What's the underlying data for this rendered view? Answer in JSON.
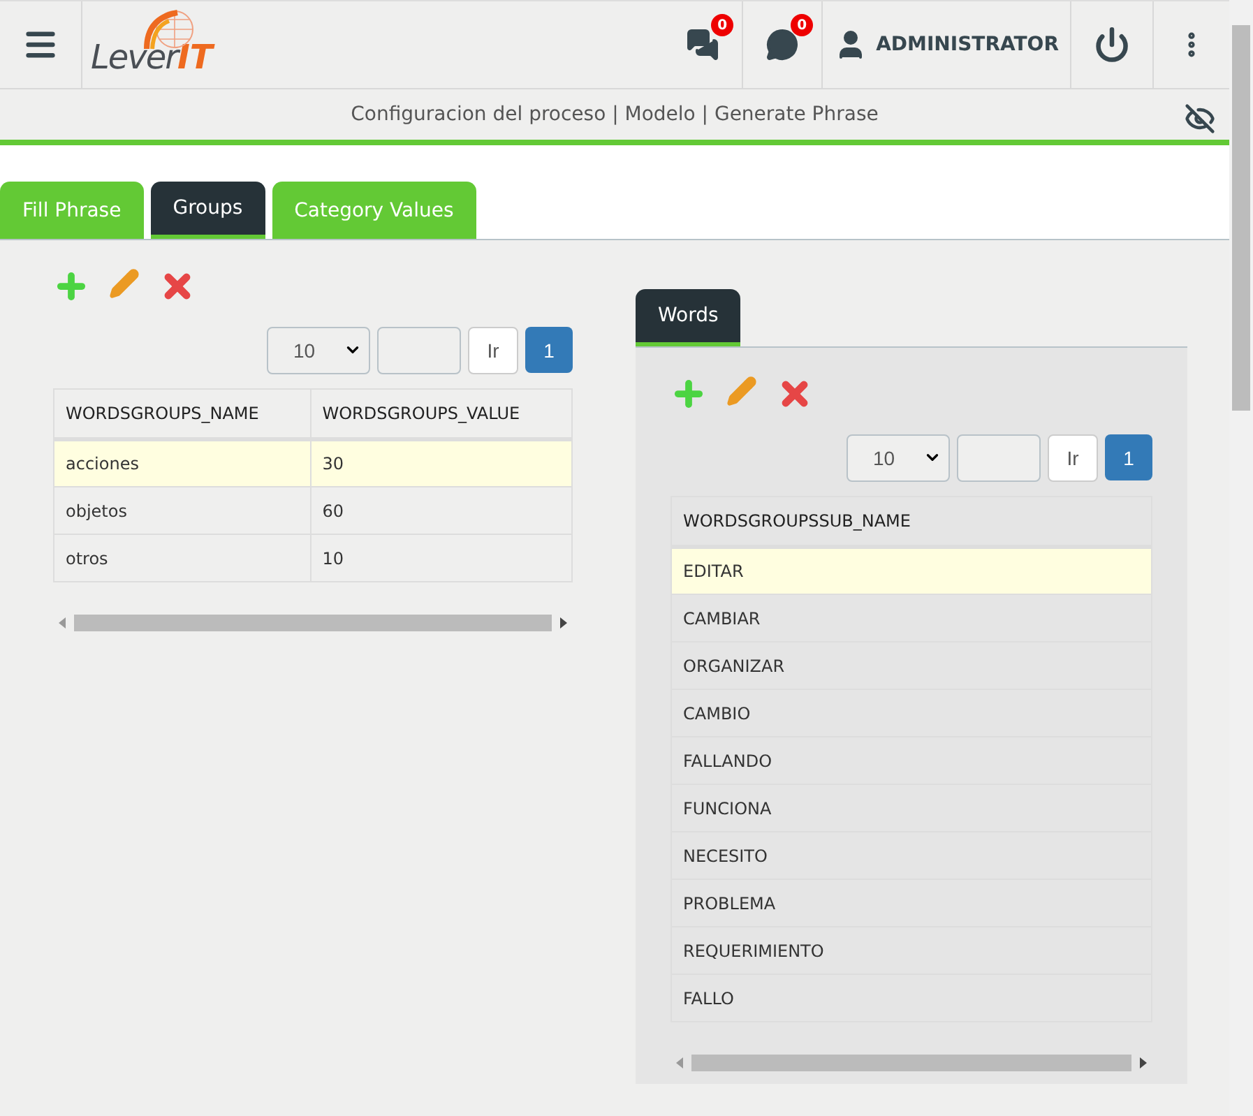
{
  "header": {
    "logo": {
      "word": "Lever",
      "accent": "IT"
    },
    "badges": [
      {
        "kind": "messages",
        "count": "0"
      },
      {
        "kind": "chat",
        "count": "0"
      }
    ],
    "user": "ADMINISTRATOR"
  },
  "breadcrumb": "Configuracion del proceso | Modelo | Generate Phrase",
  "tabs": [
    {
      "label": "Fill Phrase",
      "selected": false
    },
    {
      "label": "Groups",
      "selected": true
    },
    {
      "label": "Category Values",
      "selected": false
    }
  ],
  "groups": {
    "pager": {
      "page_size": "10",
      "go": "Ir",
      "pages": [
        {
          "label": "1",
          "selected": true
        }
      ]
    },
    "table": {
      "columns": [
        "WORDSGROUPS_NAME",
        "WORDSGROUPS_VALUE"
      ],
      "rows": [
        {
          "cells": [
            "acciones",
            "30"
          ],
          "selected": true
        },
        {
          "cells": [
            "objetos",
            "60"
          ],
          "selected": false
        },
        {
          "cells": [
            "otros",
            "10"
          ],
          "selected": false
        }
      ]
    }
  },
  "words": {
    "tab": {
      "label": "Words",
      "selected": true
    },
    "pager": {
      "page_size": "10",
      "go": "Ir",
      "pages": [
        {
          "label": "1",
          "selected": true
        }
      ]
    },
    "table": {
      "columns": [
        "WORDSGROUPSSUB_NAME"
      ],
      "rows": [
        {
          "cells": [
            "EDITAR"
          ],
          "selected": true
        },
        {
          "cells": [
            "CAMBIAR"
          ],
          "selected": false
        },
        {
          "cells": [
            "ORGANIZAR"
          ],
          "selected": false
        },
        {
          "cells": [
            "CAMBIO"
          ],
          "selected": false
        },
        {
          "cells": [
            "FALLANDO"
          ],
          "selected": false
        },
        {
          "cells": [
            "FUNCIONA"
          ],
          "selected": false
        },
        {
          "cells": [
            "NECESITO"
          ],
          "selected": false
        },
        {
          "cells": [
            "PROBLEMA"
          ],
          "selected": false
        },
        {
          "cells": [
            "REQUERIMIENTO"
          ],
          "selected": false
        },
        {
          "cells": [
            "FALLO"
          ],
          "selected": false
        }
      ]
    }
  }
}
